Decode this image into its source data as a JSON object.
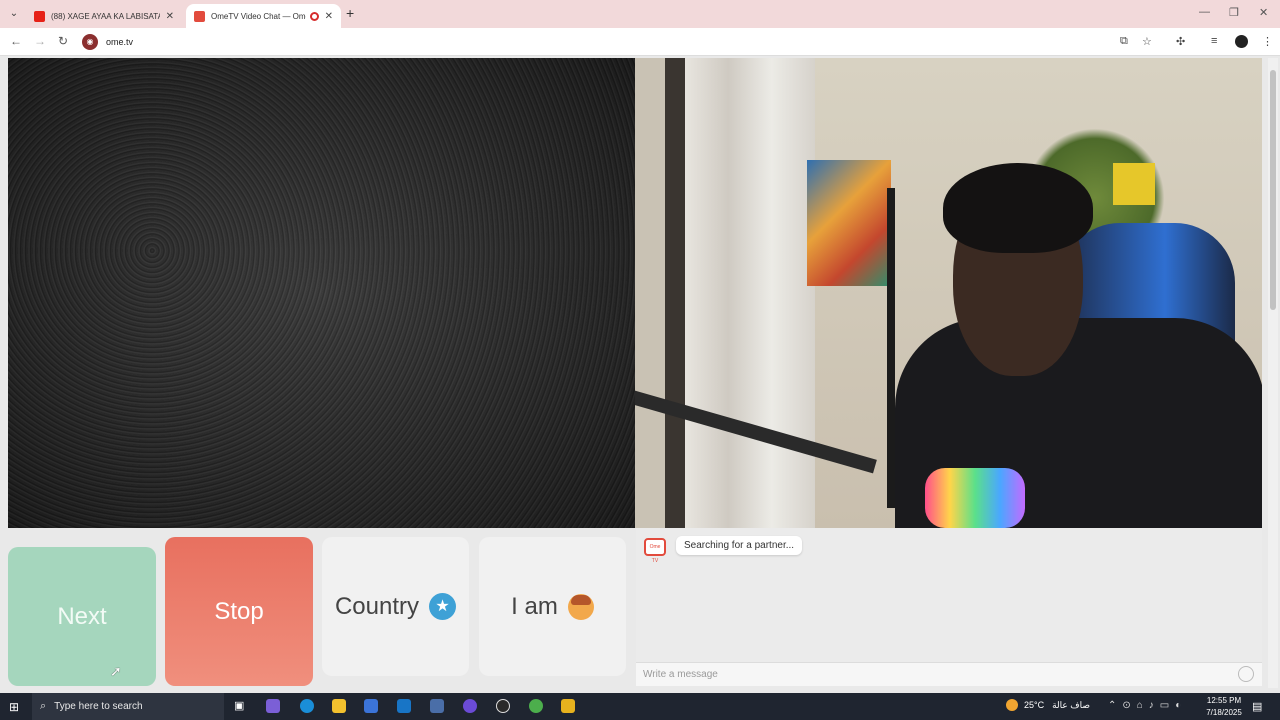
{
  "browser": {
    "tabs": [
      {
        "title": "(88) XAGE AYAA KA LABISATA H",
        "favicon": "youtube-icon",
        "active": false
      },
      {
        "title": "OmeTV Video Chat — Ome",
        "favicon": "ometv-icon",
        "active": true,
        "recording": true
      }
    ],
    "url": "ome.tv"
  },
  "controls": {
    "next_label": "Next",
    "stop_label": "Stop",
    "country_label": "Country",
    "country_icon": "★",
    "iam_label": "I am"
  },
  "chat": {
    "logo_text": "Ome TV",
    "status": "Searching for a partner...",
    "input_placeholder": "Write a message"
  },
  "taskbar": {
    "search_placeholder": "Type here to search",
    "weather": "25°C",
    "weather_desc": "صاف عالة",
    "time": "12:55 PM",
    "date": "7/18/2025"
  },
  "colors": {
    "next": "#a5d6bd",
    "stop": "#e8705f",
    "country_star": "#3ea1d6",
    "tabstrip": "#f2d9da"
  }
}
